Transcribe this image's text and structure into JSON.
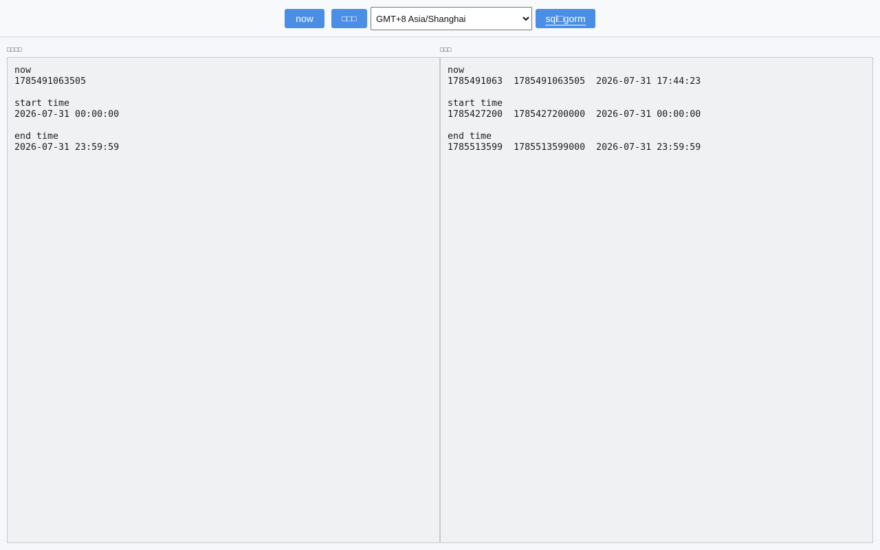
{
  "toolbar": {
    "now_label": "now",
    "second_label": "□□□",
    "sql_label": "sql□gorm",
    "timezone_selected": "GMT+8 Asia/Shanghai"
  },
  "left_pane": {
    "label": "□□□□",
    "content": "now\n1785491063505\n\nstart time\n2026-07-31 00:00:00\n\nend time\n2026-07-31 23:59:59"
  },
  "right_pane": {
    "label": "□□□",
    "content": "now\n1785491063  1785491063505  2026-07-31 17:44:23\n\nstart time\n1785427200  1785427200000  2026-07-31 00:00:00\n\nend time\n1785513599  1785513599000  2026-07-31 23:59:59"
  },
  "colors": {
    "accent": "#4a8ee5",
    "page_background": "#f5f7fa",
    "pane_background": "#f0f1f3"
  }
}
